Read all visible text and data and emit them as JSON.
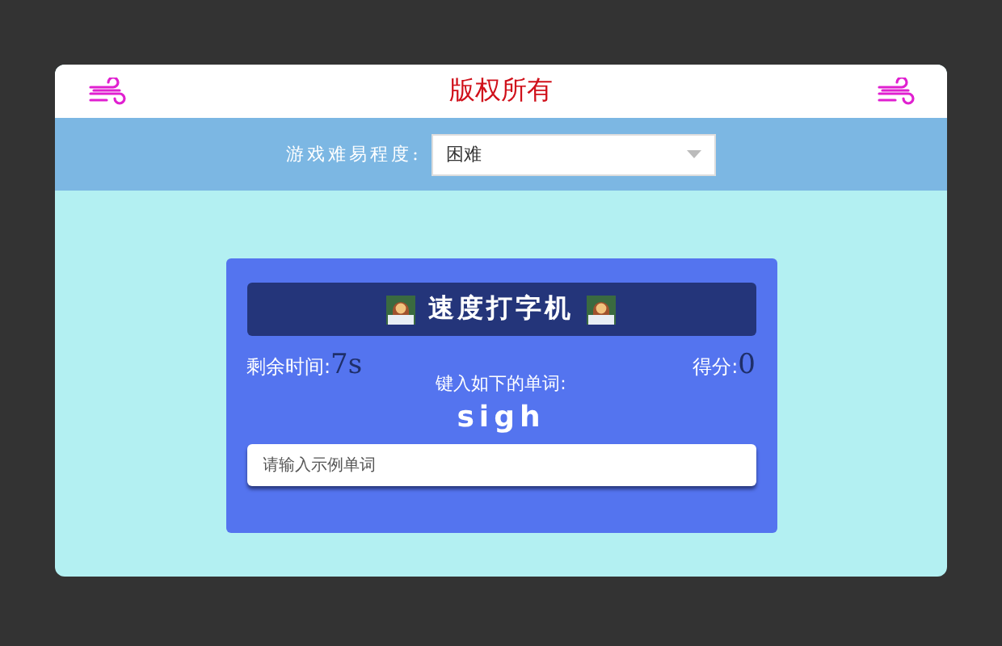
{
  "header": {
    "title": "版权所有"
  },
  "difficulty": {
    "label": "游戏难易程度:",
    "value": "困难"
  },
  "game": {
    "title": "速度打字机",
    "time_label": "剩余时间:",
    "time_value": "7s",
    "score_label": "得分:",
    "score_value": "0",
    "prompt": "键入如下的单词:",
    "word": "sigh",
    "input": {
      "placeholder": "请输入示例单词"
    }
  }
}
